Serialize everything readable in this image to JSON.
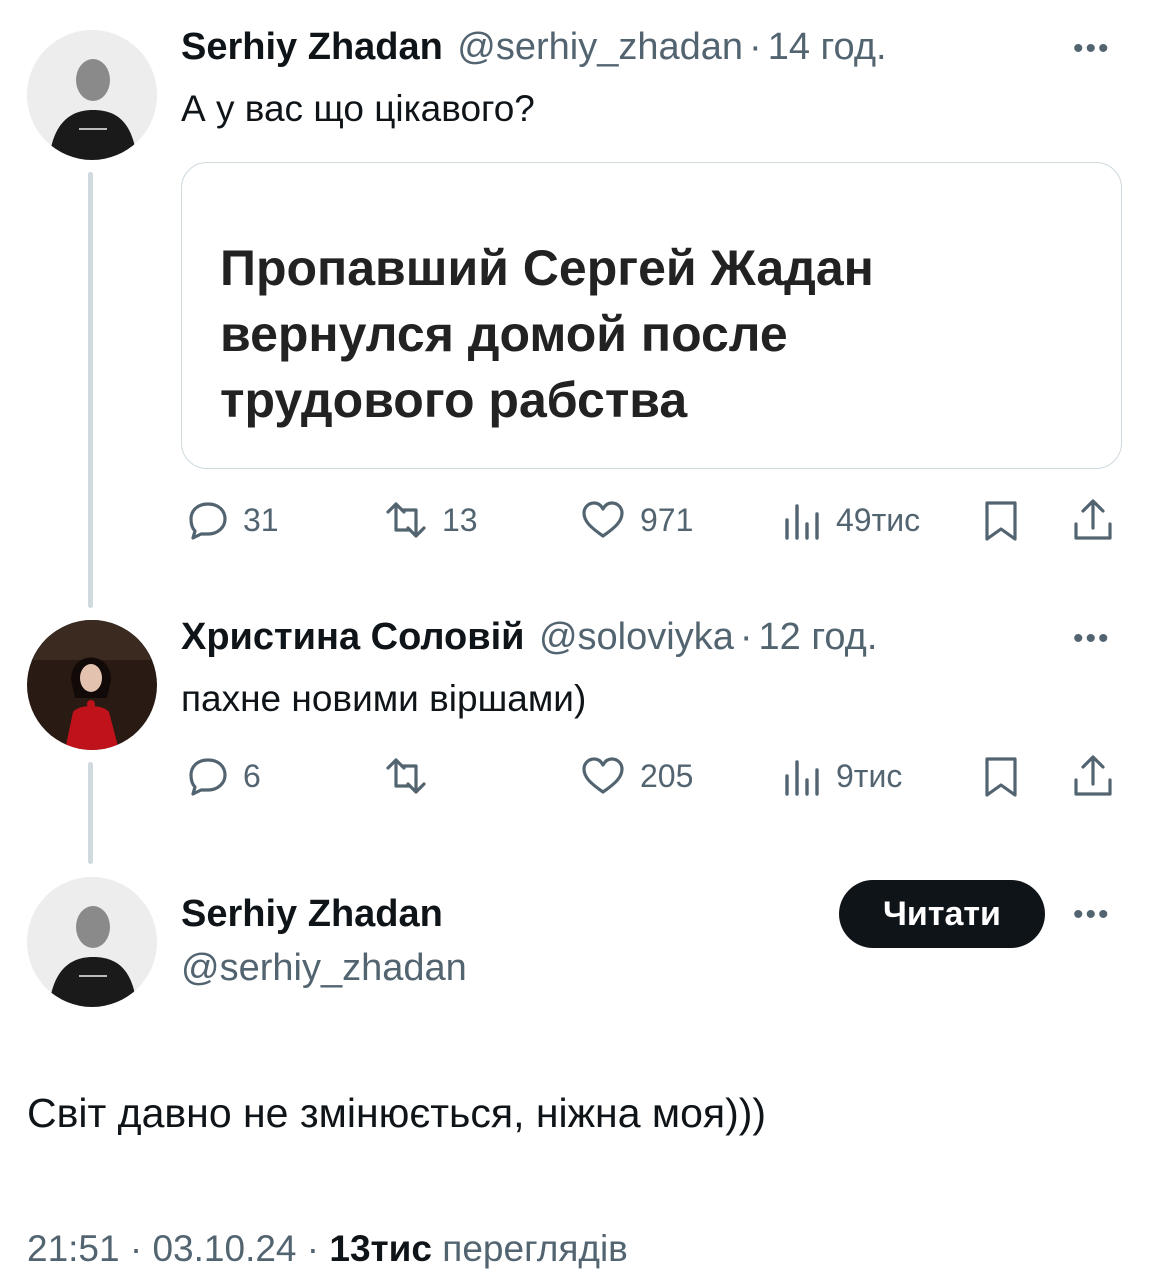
{
  "tweet1": {
    "author_name": "Serhiy Zhadan",
    "handle": "@serhiy_zhadan",
    "separator": "·",
    "time": "14 год.",
    "text": "А у вас що цікавого?",
    "card_headline_lines": [
      "Пропавший Сергей Жадан",
      "вернулся домой после",
      "трудового рабства"
    ],
    "replies": "31",
    "reposts": "13",
    "likes": "971",
    "views": "49тис"
  },
  "tweet2": {
    "author_name": "Христина Соловій",
    "handle": "@soloviyka",
    "separator": "·",
    "time": "12 год.",
    "text": "пахне новими віршами)",
    "replies": "6",
    "reposts": "",
    "likes": "205",
    "views": "9тис"
  },
  "tweet3": {
    "author_name": "Serhiy Zhadan",
    "handle": "@serhiy_zhadan",
    "follow_label": "Читати",
    "text": "Світ давно не змінюється, ніжна моя)))",
    "footer_time": "21:51",
    "footer_sep1": "·",
    "footer_date": "03.10.24",
    "footer_sep2": "·",
    "footer_views_count": "13тис",
    "footer_views_label": "переглядів"
  },
  "icons": {
    "more": "more-icon",
    "reply": "reply-icon",
    "repost": "repost-icon",
    "like": "heart-icon",
    "views": "views-icon",
    "bookmark": "bookmark-icon",
    "share": "share-icon"
  },
  "colors": {
    "text": "#0f1419",
    "muted": "#536471",
    "border": "#cfd9de",
    "button_bg": "#0f1419"
  }
}
